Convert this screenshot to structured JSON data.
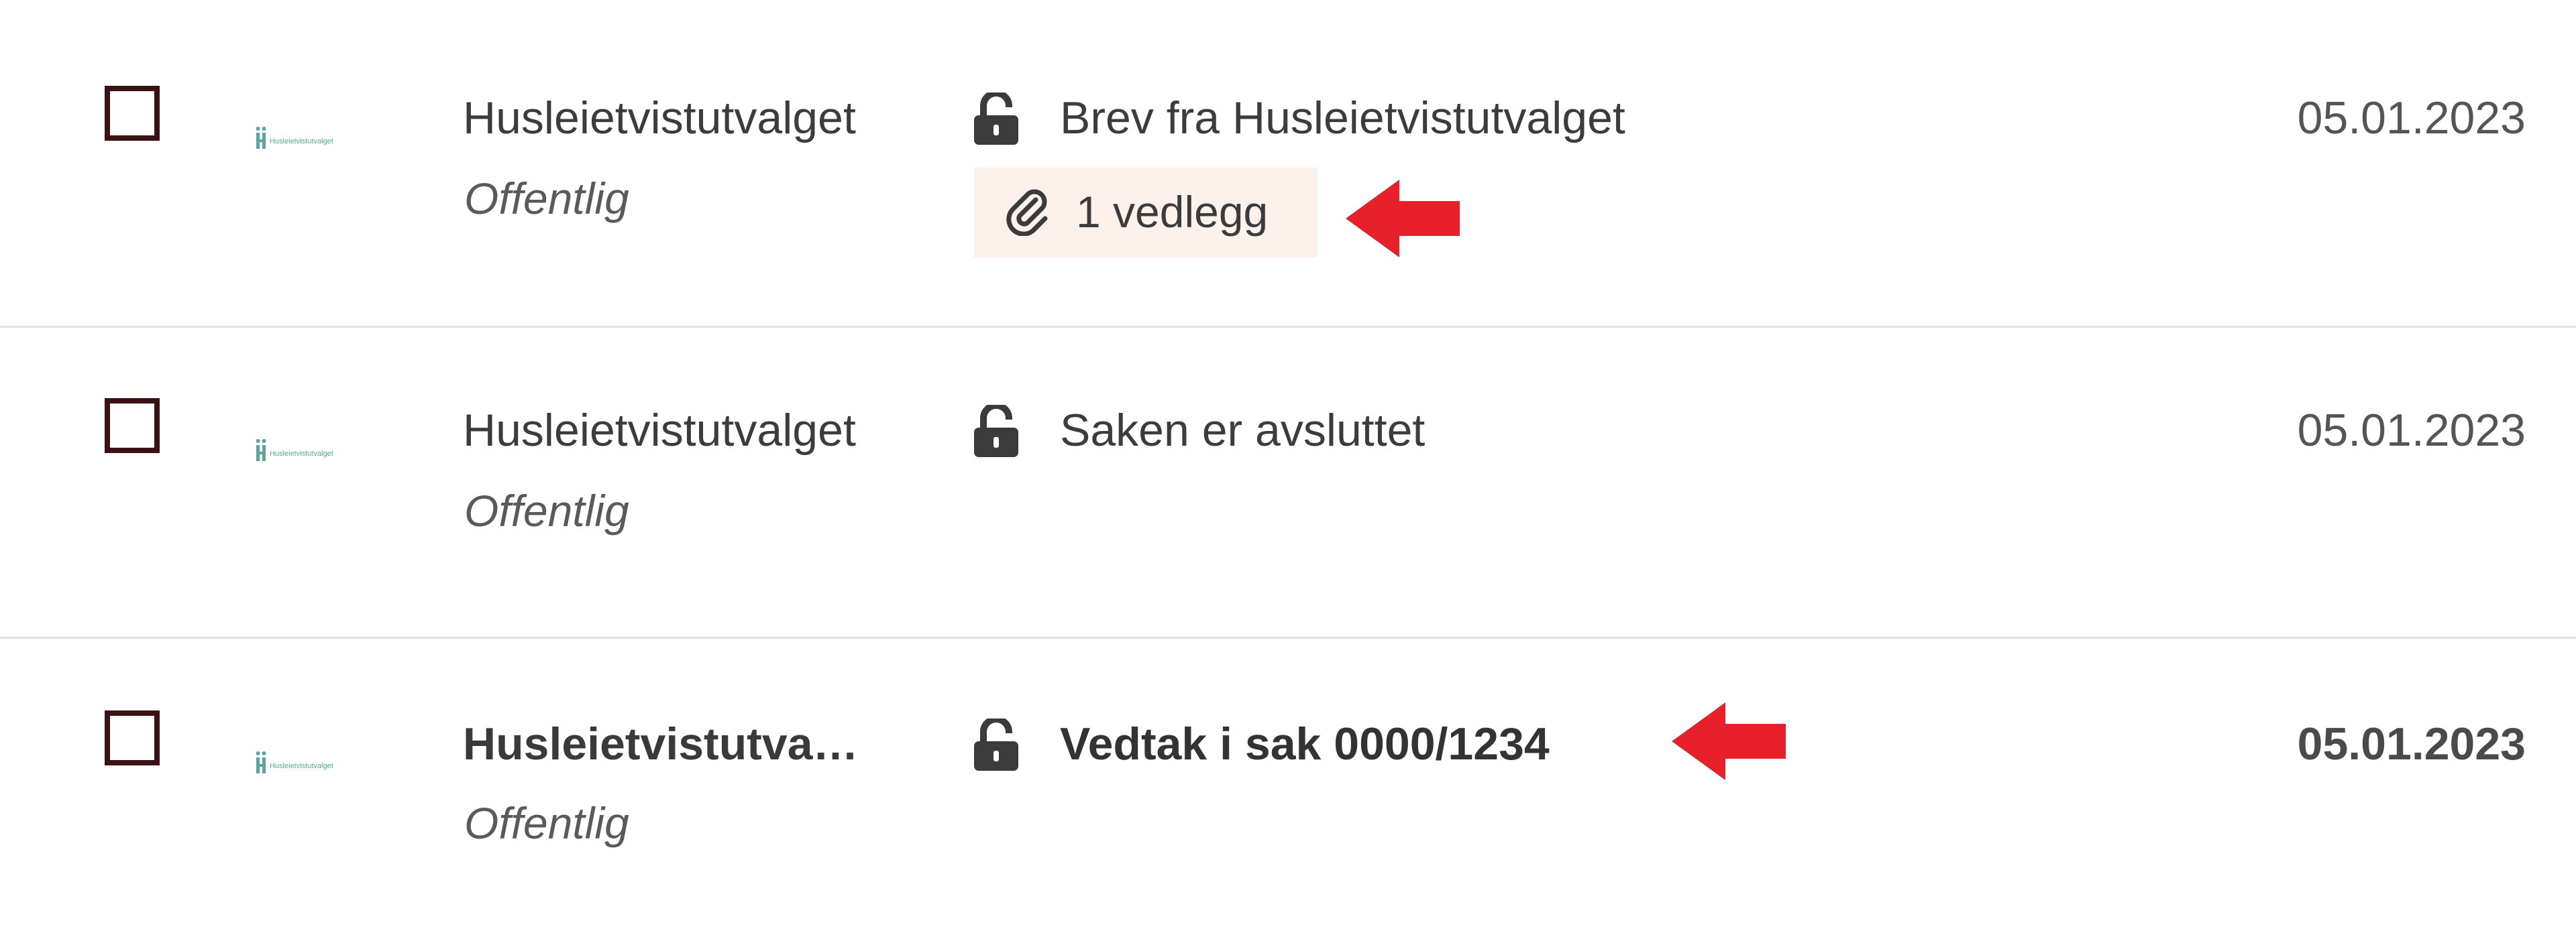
{
  "colors": {
    "checkbox_border": "#3a1214",
    "attachment_bg": "#fdf1ec",
    "divider": "#e3e3e3",
    "annotation_arrow": "#e8202a",
    "logo_teal": "#5aa5a0"
  },
  "messages": [
    {
      "logo": {
        "icon": "husleietvistutvalget-logo-icon",
        "text": "Husleietvistutvalget"
      },
      "sender": "Husleietvistutvalget",
      "category": "Offentlig",
      "lock_icon": "unlocked-padlock-icon",
      "subject": "Brev fra Husleietvistutvalget",
      "attachment": {
        "icon": "paperclip-icon",
        "label": "1 vedlegg"
      },
      "date": "05.01.2023",
      "unread": false
    },
    {
      "logo": {
        "icon": "husleietvistutvalget-logo-icon",
        "text": "Husleietvistutvalget"
      },
      "sender": "Husleietvistutvalget",
      "category": "Offentlig",
      "lock_icon": "unlocked-padlock-icon",
      "subject": "Saken er avsluttet",
      "date": "05.01.2023",
      "unread": false
    },
    {
      "logo": {
        "icon": "husleietvistutvalget-logo-icon",
        "text": "Husleietvistutvalget"
      },
      "sender": "Husleietvistutvalget",
      "category": "Offentlig",
      "lock_icon": "unlocked-padlock-icon",
      "subject": "Vedtak i sak 0000/1234",
      "date": "05.01.2023",
      "unread": true
    }
  ],
  "annotations": [
    {
      "icon": "red-arrow-left-icon",
      "points_to": "1 vedlegg"
    },
    {
      "icon": "red-arrow-left-icon",
      "points_to": "Vedtak i sak 0000/1234"
    }
  ]
}
